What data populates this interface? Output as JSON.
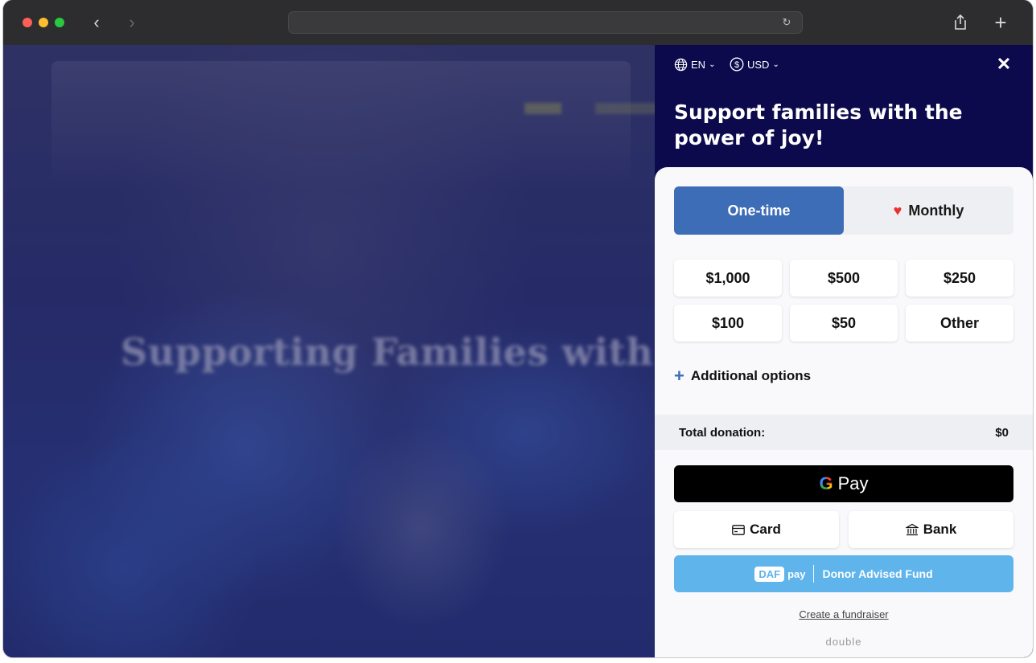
{
  "browser": {
    "back_icon": "chevron-left-icon",
    "forward_icon": "chevron-right-icon",
    "reload_icon": "reload-icon",
    "share_icon": "share-icon",
    "new_tab_icon": "plus-icon"
  },
  "background": {
    "headline": "Supporting Families with the"
  },
  "panel": {
    "language": "EN",
    "currency": "USD",
    "headline": "Support families with the power of joy!",
    "frequency": {
      "one_time": "One-time",
      "monthly": "Monthly",
      "selected": "One-time"
    },
    "amounts": [
      "$1,000",
      "$500",
      "$250",
      "$100",
      "$50",
      "Other"
    ],
    "additional_options": "Additional options",
    "total_label": "Total donation:",
    "total_value": "$0",
    "gpay_label": "Pay",
    "card_label": "Card",
    "bank_label": "Bank",
    "daf_box": "DAF",
    "daf_pay": "pay",
    "daf_label": "Donor Advised Fund",
    "fundraiser_link": "Create a fundraiser",
    "brand": "double"
  },
  "colors": {
    "panel_bg": "#0c0a4d",
    "accent": "#3e6db7",
    "heart": "#e8312b",
    "daf": "#5fb4ec"
  }
}
